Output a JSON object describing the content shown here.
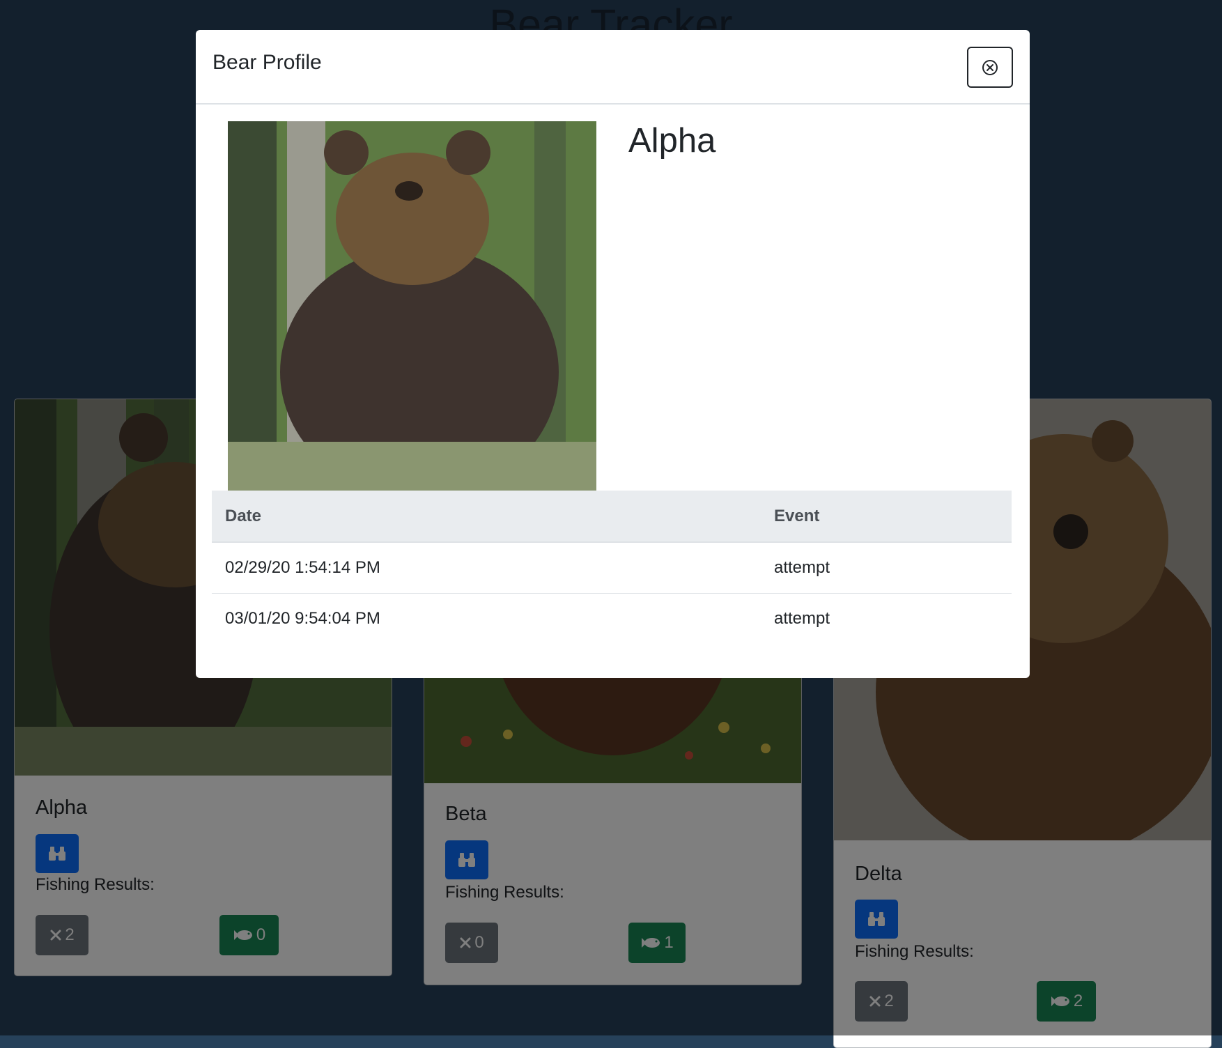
{
  "app": {
    "title": "Bear Tracker"
  },
  "cards": [
    {
      "name": "Alpha",
      "fishing_label": "Fishing Results:",
      "misses": "2",
      "catches": "0"
    },
    {
      "name": "Beta",
      "fishing_label": "Fishing Results:",
      "misses": "0",
      "catches": "1"
    },
    {
      "name": "Delta",
      "fishing_label": "Fishing Results:",
      "misses": "2",
      "catches": "2"
    }
  ],
  "icons": {
    "spot": "binoculars-icon",
    "miss": "x-icon",
    "catch": "fish-icon",
    "close": "close-circle-icon"
  },
  "colors": {
    "background": "#26415a",
    "primary": "#0d6efd",
    "secondary": "#6c757d",
    "success": "#198754"
  },
  "modal": {
    "title": "Bear Profile",
    "bear_name": "Alpha",
    "table": {
      "headers": [
        "Date",
        "Event"
      ],
      "rows": [
        {
          "date": "02/29/20 1:54:14 PM",
          "event": "attempt"
        },
        {
          "date": "03/01/20 9:54:04 PM",
          "event": "attempt"
        }
      ]
    }
  }
}
